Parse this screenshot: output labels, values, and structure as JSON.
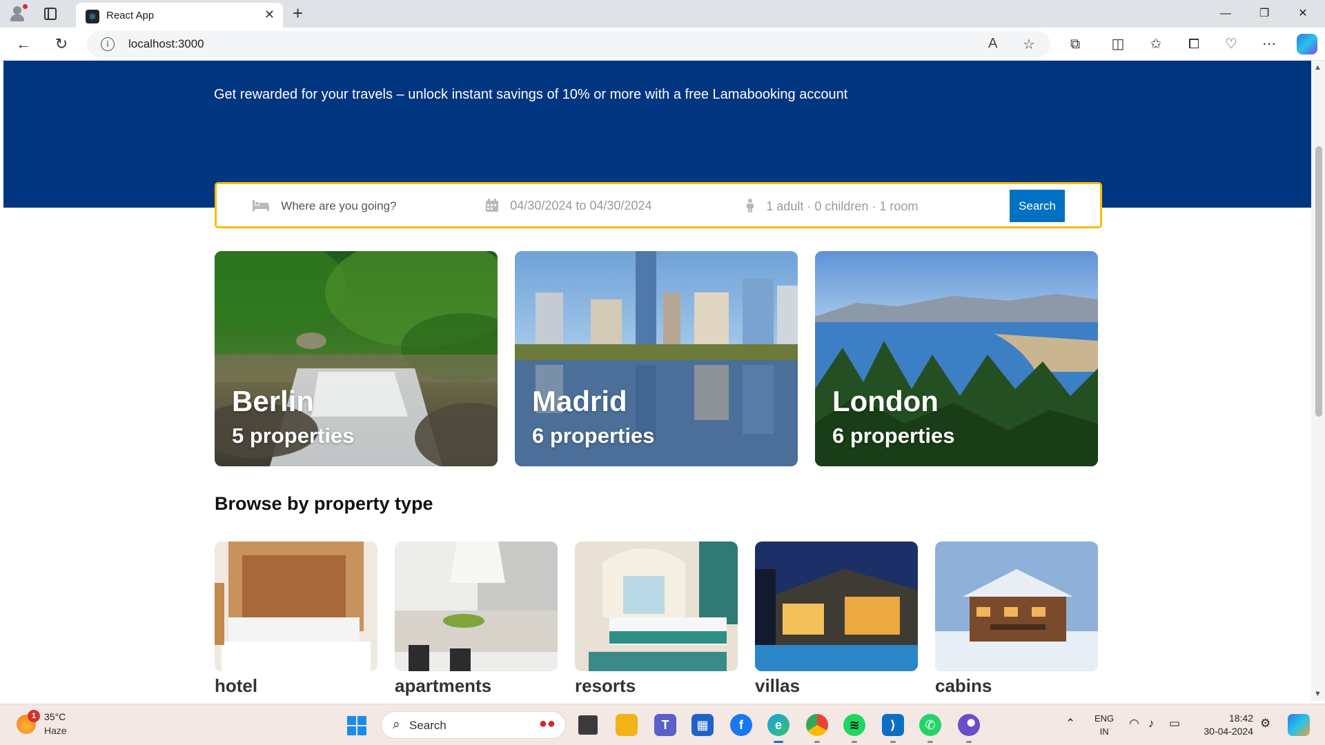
{
  "browser": {
    "tab_title": "React App",
    "tab_close": "✕",
    "new_tab": "+",
    "url": "localhost:3000",
    "window_controls": {
      "minimize": "—",
      "maximize": "❐",
      "close": "✕"
    }
  },
  "hero": {
    "description": "Get rewarded for your travels – unlock instant savings of 10% or more with a free Lamabooking account"
  },
  "search": {
    "destination_placeholder": "Where are you going?",
    "date_range": "04/30/2024 to 04/30/2024",
    "options": "1 adult · 0 children · 1 room",
    "button_label": "Search"
  },
  "featured": [
    {
      "city": "Berlin",
      "count": "5 properties"
    },
    {
      "city": "Madrid",
      "count": "6 properties"
    },
    {
      "city": "London",
      "count": "6 properties"
    }
  ],
  "property_section": {
    "title": "Browse by property type",
    "types": [
      {
        "name": "hotel"
      },
      {
        "name": "apartments"
      },
      {
        "name": "resorts"
      },
      {
        "name": "villas"
      },
      {
        "name": "cabins"
      }
    ]
  },
  "taskbar": {
    "weather_badge": "1",
    "temperature": "35°C",
    "condition": "Haze",
    "search_label": "Search",
    "lang_line1": "ENG",
    "lang_line2": "IN",
    "time": "18:42",
    "date": "30-04-2024"
  }
}
